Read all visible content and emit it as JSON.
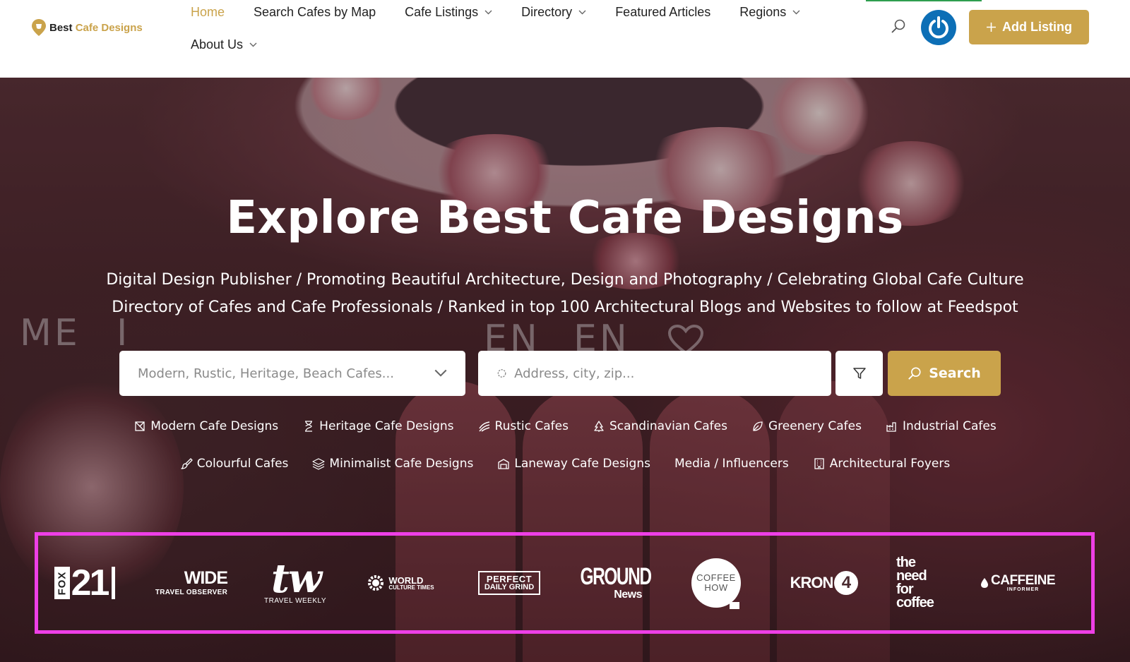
{
  "header": {
    "logo": {
      "word1": "Best",
      "word2": "Cafe Designs"
    },
    "nav": [
      {
        "label": "Home",
        "active": true,
        "dropdown": false
      },
      {
        "label": "Search Cafes by Map",
        "active": false,
        "dropdown": false
      },
      {
        "label": "Cafe Listings",
        "active": false,
        "dropdown": true
      },
      {
        "label": "Directory",
        "active": false,
        "dropdown": true
      },
      {
        "label": "Featured Articles",
        "active": false,
        "dropdown": false
      },
      {
        "label": "Regions",
        "active": false,
        "dropdown": true
      },
      {
        "label": "About Us",
        "active": false,
        "dropdown": true
      }
    ],
    "add_listing_label": "Add Listing"
  },
  "hero": {
    "title": "Explore Best Cafe Designs",
    "subtitle_line1": "Digital Design Publisher / Promoting Beautiful Architecture, Design and Photography / Celebrating Global Cafe Culture",
    "subtitle_line2": "Directory of Cafes and Cafe Professionals / Ranked in top 100 Architectural Blogs and Websites to follow at Feedspot",
    "category_placeholder": "Modern, Rustic, Heritage, Beach Cafes...",
    "location_placeholder": "Address, city, zip...",
    "search_label": "Search",
    "categories_row1": [
      "Modern Cafe Designs",
      "Heritage Cafe Designs",
      "Rustic Cafes",
      "Scandinavian Cafes",
      "Greenery Cafes",
      "Industrial Cafes"
    ],
    "categories_row2": [
      "Colourful Cafes",
      "Minimalist Cafe Designs",
      "Laneway Cafe Designs",
      "Media / Influencers",
      "Architectural Foyers"
    ],
    "background_letters": [
      "ME",
      "I",
      "EN",
      "EN"
    ]
  },
  "media_logos": {
    "fox": {
      "text": "21",
      "vertical": "FOX"
    },
    "wide": {
      "text": "WIDE",
      "sub": "TRAVEL OBSERVER"
    },
    "tw": {
      "text": "tw",
      "sub": "TRAVEL WEEKLY"
    },
    "world": {
      "text": "WORLD",
      "sub": "CULTURE TIMES"
    },
    "perfect": {
      "text": "PERFECT",
      "sub": "DAILY GRIND"
    },
    "ground": {
      "text": "GROUND",
      "sub": "News"
    },
    "coffeehow": {
      "text": "COFFEE",
      "sub": "HOW"
    },
    "kron": {
      "text": "KRON",
      "num": "4"
    },
    "needfor": {
      "l1": "the",
      "l2": "need",
      "l3": "for",
      "l4": "coffee"
    },
    "caffeine": {
      "text": "CAFFEINE",
      "sub": "INFORMER"
    }
  },
  "colors": {
    "accent": "#caa34b",
    "highlight_border": "#ee3fe6",
    "avatar": "#0d6fb6"
  }
}
